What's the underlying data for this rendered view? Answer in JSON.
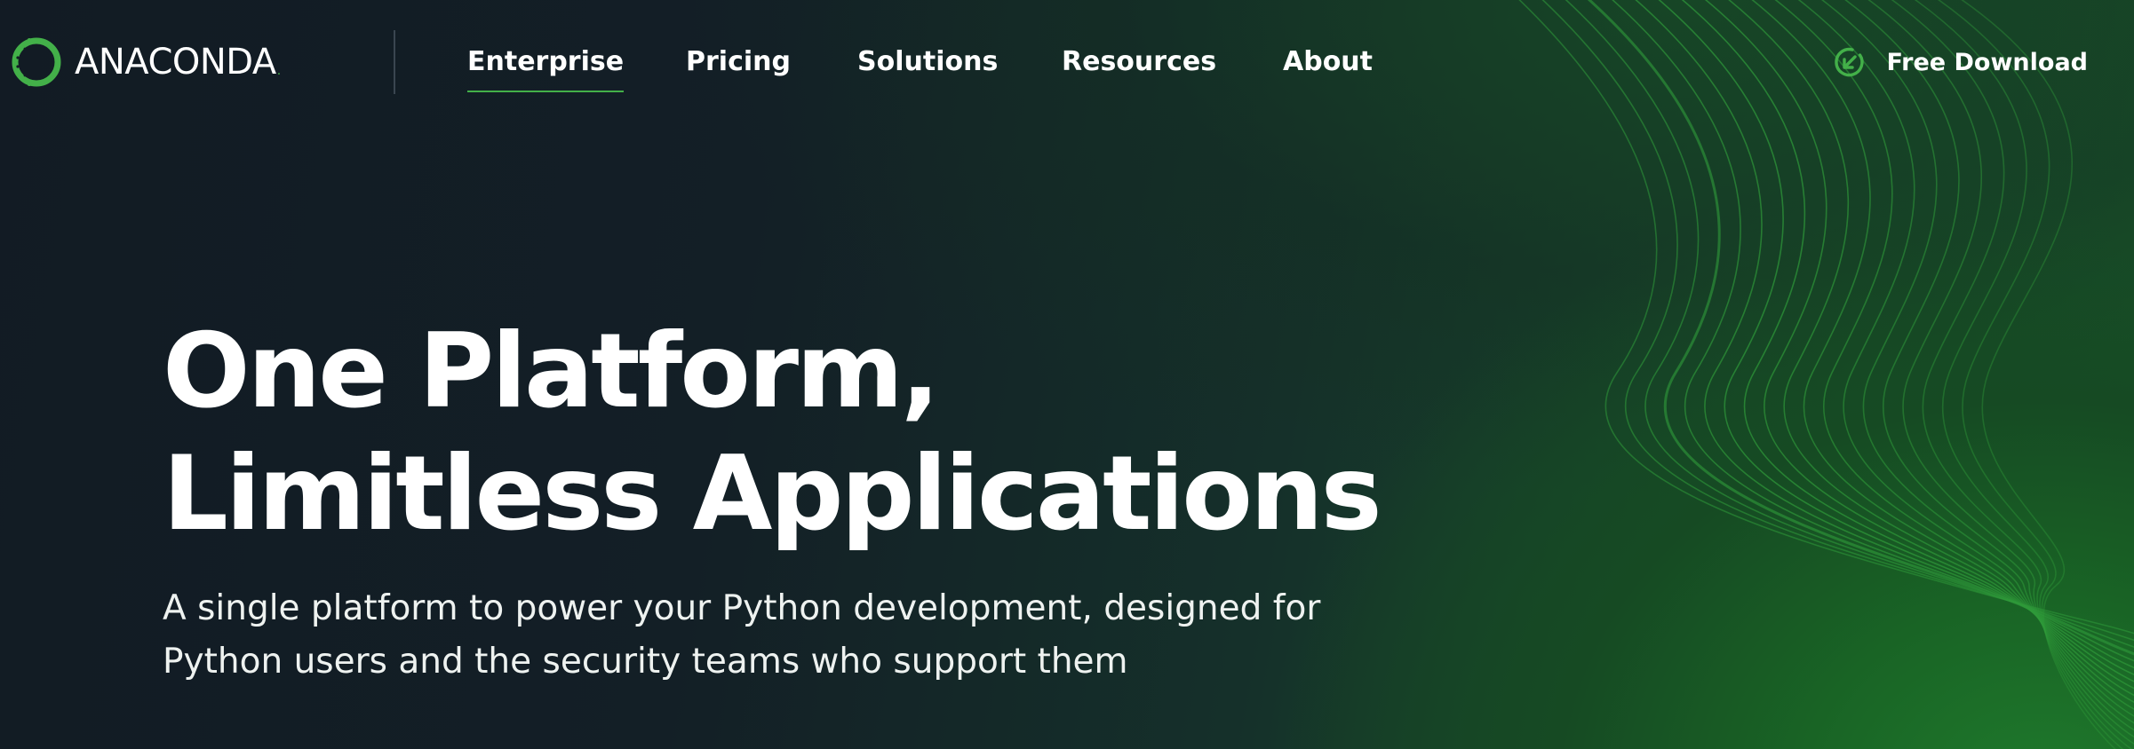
{
  "brand": {
    "name": "ANACONDA",
    "trademark": "."
  },
  "nav": {
    "items": [
      {
        "label": "Enterprise",
        "active": true
      },
      {
        "label": "Pricing",
        "active": false
      },
      {
        "label": "Solutions",
        "active": false
      },
      {
        "label": "Resources",
        "active": false
      },
      {
        "label": "About",
        "active": false
      }
    ],
    "cta_label": "Free Download",
    "cta_icon": "download-circle-icon"
  },
  "hero": {
    "title_line1": "One Platform,",
    "title_line2": "Limitless Applications",
    "subtitle": "A single platform to power your Python development, designed for Python users and the security teams who support them"
  },
  "colors": {
    "brand_green": "#43b049",
    "background_dark": "#121c24",
    "background_green": "#1f7a2c",
    "text": "#ffffff"
  }
}
